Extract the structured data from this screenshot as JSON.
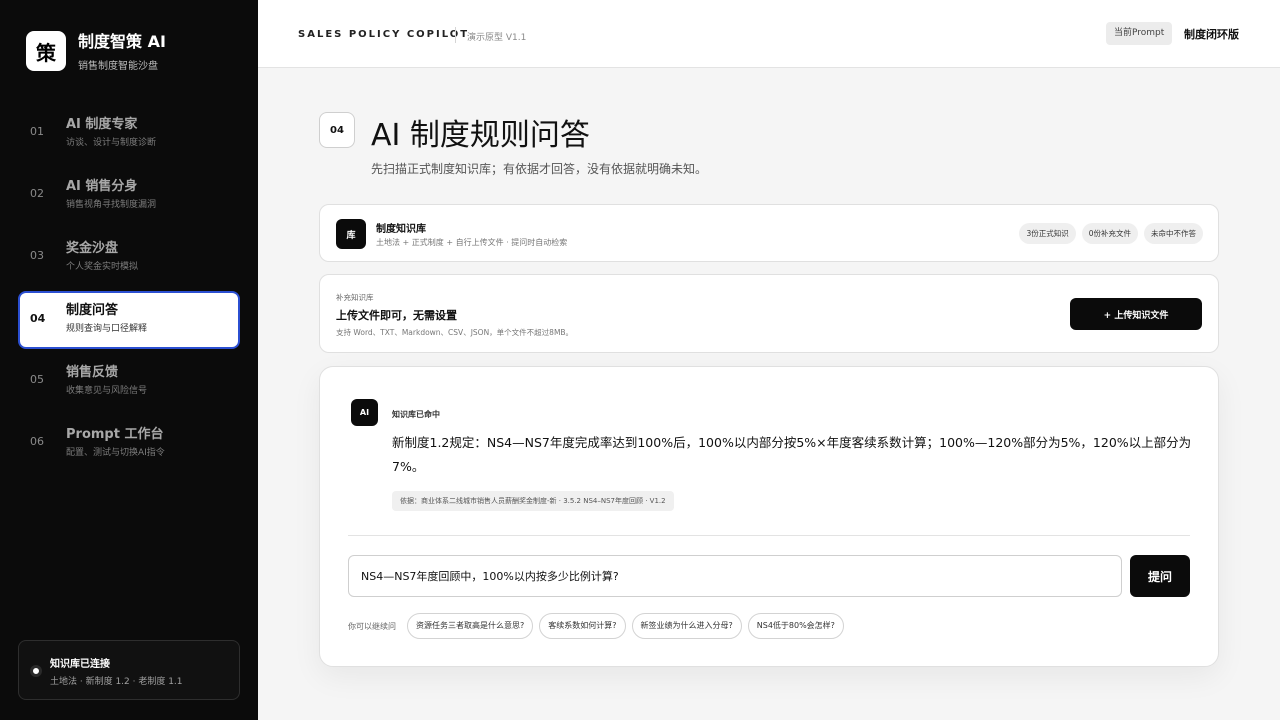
{
  "brand": {
    "logo_char": "策",
    "title": "制度智策 AI",
    "subtitle": "销售制度智能沙盘"
  },
  "nav": [
    {
      "num": "01",
      "label": "AI 制度专家",
      "desc": "访谈、设计与制度诊断"
    },
    {
      "num": "02",
      "label": "AI 销售分身",
      "desc": "销售视角寻找制度漏洞"
    },
    {
      "num": "03",
      "label": "奖金沙盘",
      "desc": "个人奖金实时模拟"
    },
    {
      "num": "04",
      "label": "制度问答",
      "desc": "规则查询与口径解释",
      "active": true
    },
    {
      "num": "05",
      "label": "销售反馈",
      "desc": "收集意见与风险信号"
    },
    {
      "num": "06",
      "label": "Prompt 工作台",
      "desc": "配置、测试与切换AI指令"
    }
  ],
  "kb_status": {
    "title": "知识库已连接",
    "sub": "土地法 · 新制度 1.2 · 老制度 1.1"
  },
  "topbar": {
    "title": "SALES POLICY COPILOT",
    "version": "演示原型 V1.1",
    "prompt_pill": "当前Prompt",
    "mode": "制度闭环版"
  },
  "page": {
    "num": "04",
    "title": "AI 制度规则问答",
    "desc": "先扫描正式制度知识库；有依据才回答，没有依据就明确未知。"
  },
  "kb_card": {
    "badge": "库",
    "name": "制度知识库",
    "sources": "土地法 + 正式制度 + 自行上传文件 · 提问时自动检索",
    "chips": [
      "3份正式知识",
      "0份补充文件",
      "未命中不作答"
    ]
  },
  "upload": {
    "tag": "补充知识库",
    "title": "上传文件即可，无需设置",
    "note": "支持 Word、TXT、Markdown、CSV、JSON，单个文件不超过8MB。",
    "button": "+ 上传知识文件"
  },
  "chat": {
    "avatar": "AI",
    "hit": "知识库已命中",
    "answer": "新制度1.2规定：NS4—NS7年度完成率达到100%后，100%以内部分按5%×年度客续系数计算；100%—120%部分为5%，120%以上部分为7%。",
    "basis": "依据：商业体系二线城市销售人员薪酬奖金制度-新 · 3.5.2 NS4–NS7年度回顾 · V1.2",
    "input_value": "NS4—NS7年度回顾中，100%以内按多少比例计算?",
    "ask_button": "提问",
    "follow_label": "你可以继续问",
    "follow_ups": [
      "资源任务三者取高是什么意思?",
      "客续系数如何计算?",
      "新签业绩为什么进入分母?",
      "NS4低于80%会怎样?"
    ]
  }
}
